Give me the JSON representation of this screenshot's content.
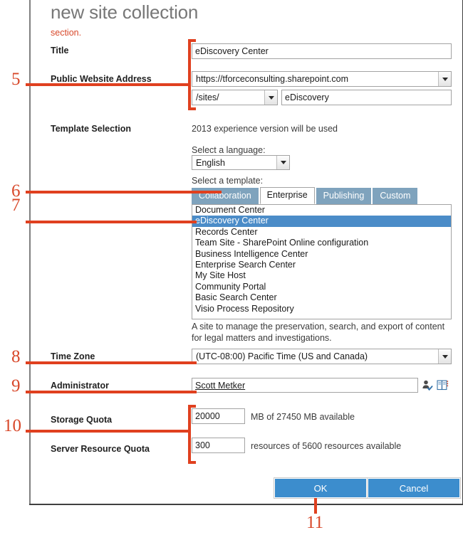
{
  "dialog": {
    "title": "new site collection",
    "section_note": "section.",
    "fields": {
      "title_label": "Title",
      "title_value": "eDiscovery Center",
      "address_label": "Public Website Address",
      "address_host": "https://tforceconsulting.sharepoint.com",
      "address_path": "/sites/",
      "address_name": "eDiscovery",
      "template_label": "Template Selection",
      "experience_note": "2013 experience version will be used",
      "language_prompt": "Select a language:",
      "language_value": "English",
      "template_prompt": "Select a template:",
      "template_description": "A site to manage the preservation, search, and export of content for legal matters and investigations.",
      "timezone_label": "Time Zone",
      "timezone_value": "(UTC-08:00) Pacific Time (US and Canada)",
      "administrator_label": "Administrator",
      "administrator_value": "Scott Metker",
      "storage_quota_label": "Storage Quota",
      "storage_quota_value": "20000",
      "storage_quota_suffix": "MB of 27450 MB available",
      "resource_quota_label": "Server Resource Quota",
      "resource_quota_value": "300",
      "resource_quota_suffix": "resources of 5600 resources available"
    },
    "template_tabs": [
      {
        "label": "Collaboration",
        "active": false
      },
      {
        "label": "Enterprise",
        "active": true
      },
      {
        "label": "Publishing",
        "active": false
      },
      {
        "label": "Custom",
        "active": false
      }
    ],
    "template_list": [
      {
        "label": "Document Center",
        "selected": false
      },
      {
        "label": "eDiscovery Center",
        "selected": true
      },
      {
        "label": "Records Center",
        "selected": false
      },
      {
        "label": "Team Site - SharePoint Online configuration",
        "selected": false
      },
      {
        "label": "Business Intelligence Center",
        "selected": false
      },
      {
        "label": "Enterprise Search Center",
        "selected": false
      },
      {
        "label": "My Site Host",
        "selected": false
      },
      {
        "label": "Community Portal",
        "selected": false
      },
      {
        "label": "Basic Search Center",
        "selected": false
      },
      {
        "label": "Visio Process Repository",
        "selected": false
      }
    ],
    "buttons": {
      "ok": "OK",
      "cancel": "Cancel"
    },
    "icons": {
      "check_names": "check-names-icon",
      "address_book": "address-book-icon"
    }
  },
  "annotations": {
    "n5": "5",
    "n6": "6",
    "n7": "7",
    "n8": "8",
    "n9": "9",
    "n10": "10",
    "n11": "11"
  },
  "colors": {
    "accent_blue": "#3c8dcd",
    "select_blue": "#4b8cc8",
    "tab_blue": "#7fa3bd",
    "annotation_red": "#e0401f",
    "title_gray": "#777777"
  }
}
